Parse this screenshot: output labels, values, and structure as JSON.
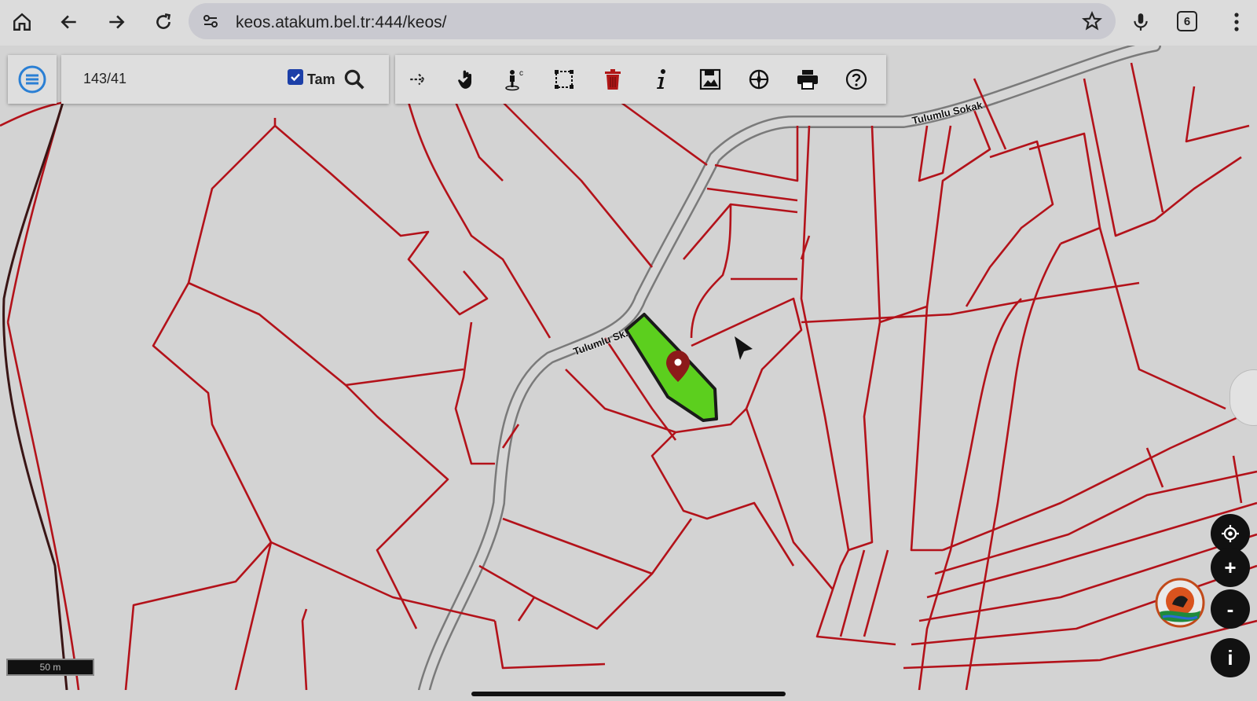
{
  "browser": {
    "url": "keos.atakum.bel.tr:444/keos/",
    "tab_count": "6",
    "icons": [
      "home-icon",
      "back-icon",
      "forward-icon",
      "reload-icon",
      "site-settings-icon",
      "star-icon",
      "microphone-icon",
      "tabs-icon",
      "more-icon"
    ]
  },
  "search": {
    "parcel_value": "143/41",
    "exact_label": "Tam",
    "exact_checked": true
  },
  "toolbar": {
    "tools": [
      "arrow-tool-icon",
      "pan-hand-icon",
      "coordinate-person-icon",
      "select-box-icon",
      "trash-icon",
      "info-icon",
      "save-image-icon",
      "compass-icon",
      "print-icon",
      "help-icon"
    ]
  },
  "map": {
    "street_label_top": "Tulumlu Sokak",
    "street_label_mid": "Tulumlu Sk.",
    "scale_label": "50 m",
    "highlight_color": "#5ccf1e",
    "parcel_line_color": "#b3121a",
    "road_fill_color": "#d6d6d6"
  },
  "controls": {
    "zoom_in": "+",
    "zoom_out": "-",
    "info": "i"
  }
}
